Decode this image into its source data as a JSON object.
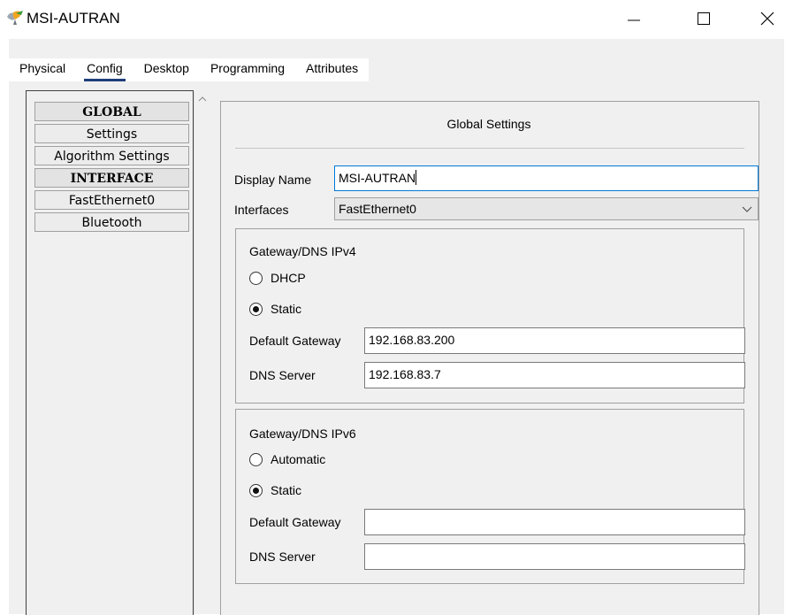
{
  "window": {
    "title": "MSI-AUTRAN"
  },
  "tabs": [
    "Physical",
    "Config",
    "Desktop",
    "Programming",
    "Attributes"
  ],
  "active_tab": "Config",
  "nav": {
    "items": [
      {
        "label": "GLOBAL",
        "header": true
      },
      {
        "label": "Settings",
        "header": false
      },
      {
        "label": "Algorithm Settings",
        "header": false
      },
      {
        "label": "INTERFACE",
        "header": true
      },
      {
        "label": "FastEthernet0",
        "header": false
      },
      {
        "label": "Bluetooth",
        "header": false
      }
    ]
  },
  "global_settings": {
    "title": "Global Settings",
    "display_name_label": "Display Name",
    "display_name_value": "MSI-AUTRAN",
    "interfaces_label": "Interfaces",
    "interfaces_value": "FastEthernet0"
  },
  "ipv4": {
    "title": "Gateway/DNS IPv4",
    "option_dhcp": "DHCP",
    "option_static": "Static",
    "selected": "Static",
    "gateway_label": "Default Gateway",
    "gateway_value": "192.168.83.200",
    "dns_label": "DNS Server",
    "dns_value": "192.168.83.7"
  },
  "ipv6": {
    "title": "Gateway/DNS IPv6",
    "option_automatic": "Automatic",
    "option_static": "Static",
    "selected": "Static",
    "gateway_label": "Default Gateway",
    "gateway_value": "",
    "dns_label": "DNS Server",
    "dns_value": ""
  },
  "icons": {
    "app": "packet-tracer-pc-icon",
    "minimize": "minimize-icon",
    "maximize": "maximize-icon",
    "close": "close-icon",
    "dropdown": "chevron-down-icon",
    "scroll_up": "scroll-up-icon"
  },
  "colors": {
    "active_tab_underline": "#1f3e7a",
    "focus_border": "#0078d7",
    "panel_bg": "#f0f0f0"
  }
}
